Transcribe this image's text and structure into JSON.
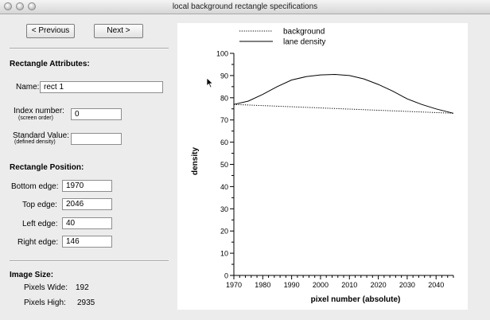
{
  "window": {
    "title": "local background rectangle specifications"
  },
  "nav": {
    "previous_label": "< Previous",
    "next_label": "Next >"
  },
  "attributes": {
    "heading": "Rectangle Attributes:",
    "name_label": "Name:",
    "name_value": "rect 1",
    "index_label": "Index number:",
    "index_sublabel": "(screen order)",
    "index_value": "0",
    "standard_label": "Standard Value:",
    "standard_sublabel": "(defined density)",
    "standard_value": ""
  },
  "position": {
    "heading": "Rectangle Position:",
    "bottom_label": "Bottom edge:",
    "bottom_value": "1970",
    "top_label": "Top edge:",
    "top_value": "2046",
    "left_label": "Left edge:",
    "left_value": "40",
    "right_label": "Right edge:",
    "right_value": "146"
  },
  "image_size": {
    "heading": "Image Size:",
    "wide_label": "Pixels Wide:",
    "wide_value": "192",
    "high_label": "Pixels High:",
    "high_value": "2935"
  },
  "chart_data": {
    "type": "line",
    "xlabel": "pixel number (absolute)",
    "ylabel": "density",
    "xlim": [
      1970,
      2046
    ],
    "ylim": [
      0,
      100
    ],
    "xticks": [
      1970,
      1980,
      1990,
      2000,
      2010,
      2020,
      2030,
      2040
    ],
    "yticks": [
      0,
      10,
      20,
      30,
      40,
      50,
      60,
      70,
      80,
      90,
      100
    ],
    "legend_position": "top",
    "series": [
      {
        "name": "background",
        "style": "dotted",
        "color": "#000000",
        "x": [
          1970,
          2046
        ],
        "y": [
          77,
          73
        ]
      },
      {
        "name": "lane density",
        "style": "solid",
        "color": "#000000",
        "x": [
          1970,
          1975,
          1980,
          1985,
          1990,
          1995,
          2000,
          2005,
          2010,
          2015,
          2020,
          2025,
          2030,
          2035,
          2040,
          2046
        ],
        "y": [
          77,
          78.5,
          81.5,
          85,
          88,
          89.5,
          90.3,
          90.5,
          90,
          88.5,
          86,
          83,
          79.5,
          77,
          75,
          73
        ]
      }
    ]
  }
}
